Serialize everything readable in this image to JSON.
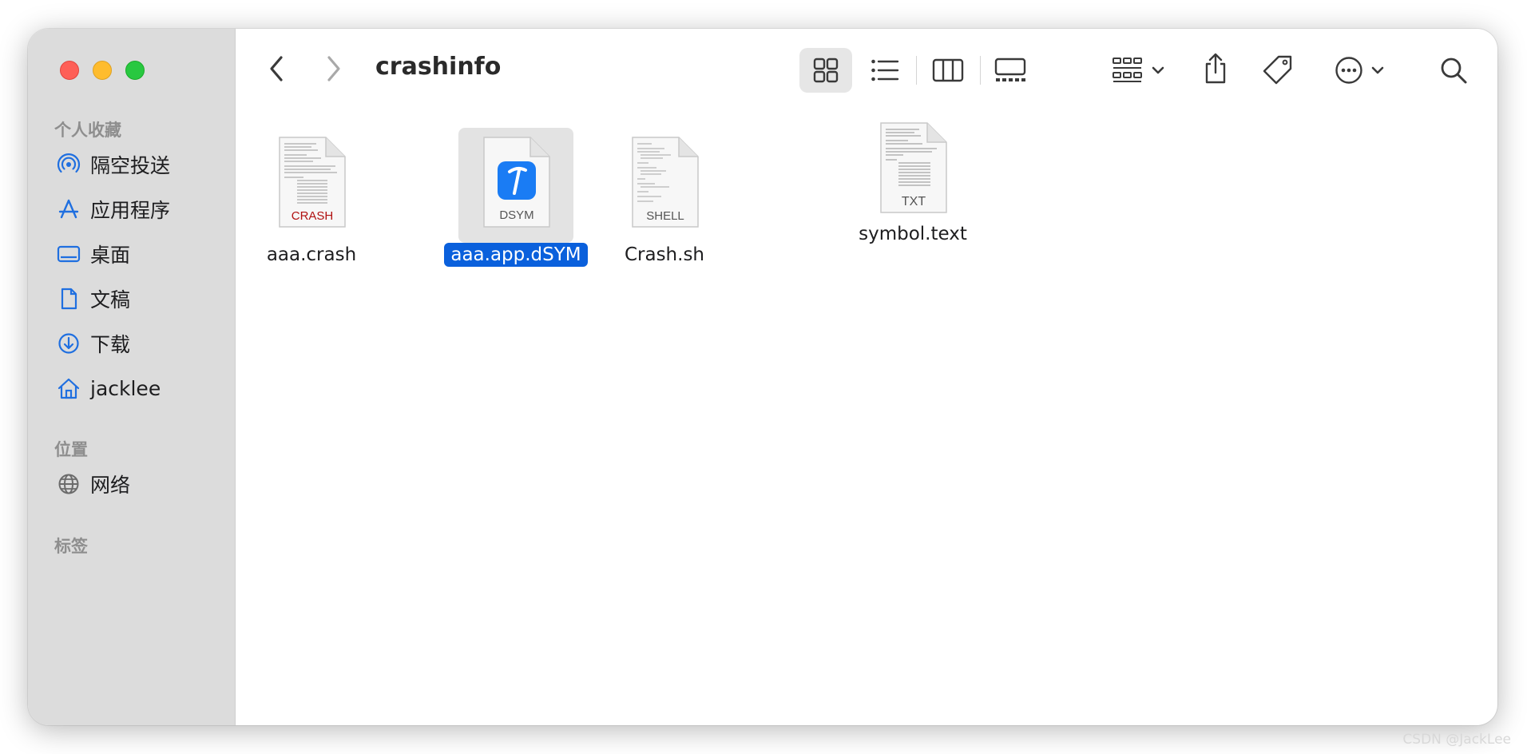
{
  "window": {
    "title": "crashinfo"
  },
  "sidebar": {
    "favorites_label": "个人收藏",
    "items": [
      {
        "label": "隔空投送",
        "icon": "airdrop-icon"
      },
      {
        "label": "应用程序",
        "icon": "applications-icon"
      },
      {
        "label": "桌面",
        "icon": "desktop-icon"
      },
      {
        "label": "文稿",
        "icon": "document-icon"
      },
      {
        "label": "下载",
        "icon": "download-icon"
      },
      {
        "label": "jacklee",
        "icon": "home-icon"
      }
    ],
    "locations_label": "位置",
    "locations": [
      {
        "label": "网络",
        "icon": "globe-icon"
      }
    ],
    "tags_label": "标签"
  },
  "files": [
    {
      "name": "aaa.crash",
      "badge": "CRASH",
      "badge_color": "#b01010",
      "selected": false
    },
    {
      "name": "aaa.app.dSYM",
      "badge": "DSYM",
      "badge_color": "#555555",
      "selected": true
    },
    {
      "name": "Crash.sh",
      "badge": "SHELL",
      "badge_color": "#555555",
      "selected": false
    },
    {
      "name": "symbol.text",
      "badge": "TXT",
      "badge_color": "#555555",
      "selected": false
    }
  ],
  "colors": {
    "accent": "#0a60dc",
    "sidebar_icon": "#1f6fe0"
  },
  "watermark": "CSDN @JackLee"
}
